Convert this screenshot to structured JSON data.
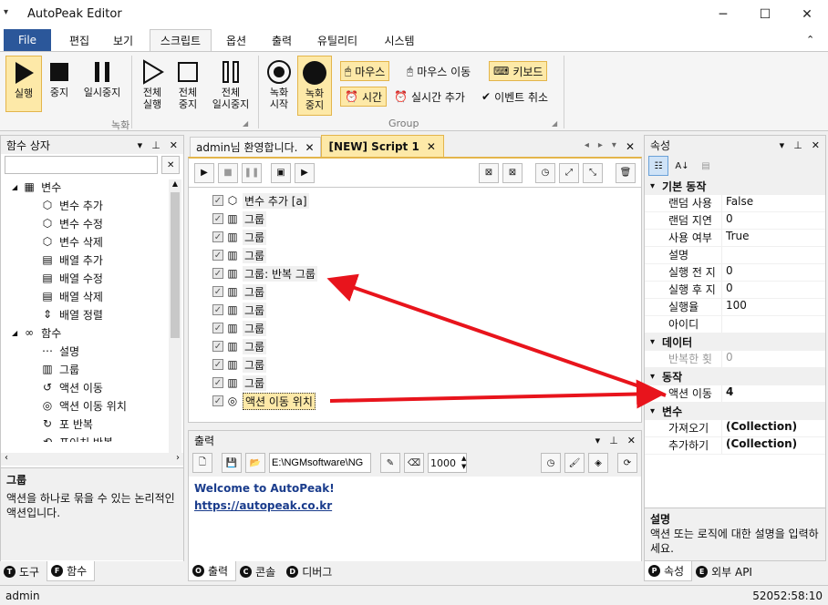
{
  "window": {
    "title": "AutoPeak Editor",
    "qa_icon": "dropdown-arrow-icon"
  },
  "menu": [
    "File",
    "편집",
    "보기",
    "스크립트",
    "옵션",
    "출력",
    "유틸리티",
    "시스템"
  ],
  "ribbon": {
    "run": "실행",
    "stop": "중지",
    "pause": "일시중지",
    "run_all": "전체\n실행",
    "stop_all": "전체\n중지",
    "pause_all": "전체\n일시중지",
    "rec_start": "녹화\n시작",
    "rec_stop": "녹화\n중지",
    "mouse": "마우스",
    "mouse_move": "마우스 이동",
    "keyboard": "키보드",
    "time": "시간",
    "realtime_add": "실시간 추가",
    "event_cancel": "이벤트 취소",
    "group_rec": "녹화",
    "group_group": "Group"
  },
  "left_panel": {
    "title": "함수 상자",
    "tree": [
      {
        "label": "변수",
        "level": 0,
        "icon": "variable-icon"
      },
      {
        "label": "변수 추가",
        "level": 1,
        "icon": "cube-add-icon"
      },
      {
        "label": "변수 수정",
        "level": 1,
        "icon": "cube-edit-icon"
      },
      {
        "label": "변수 삭제",
        "level": 1,
        "icon": "cube-delete-icon"
      },
      {
        "label": "배열 추가",
        "level": 1,
        "icon": "array-add-icon"
      },
      {
        "label": "배열 수정",
        "level": 1,
        "icon": "array-edit-icon"
      },
      {
        "label": "배열 삭제",
        "level": 1,
        "icon": "array-delete-icon"
      },
      {
        "label": "배열 정렬",
        "level": 1,
        "icon": "sort-icon"
      },
      {
        "label": "함수",
        "level": 0,
        "icon": "infinity-icon"
      },
      {
        "label": "설명",
        "level": 1,
        "icon": "comment-icon"
      },
      {
        "label": "그룹",
        "level": 1,
        "icon": "group-icon"
      },
      {
        "label": "액션 이동",
        "level": 1,
        "icon": "jump-icon"
      },
      {
        "label": "액션 이동 위치",
        "level": 1,
        "icon": "target-icon"
      },
      {
        "label": "포 반복",
        "level": 1,
        "icon": "loop-icon"
      },
      {
        "label": "포이치 반복",
        "level": 1,
        "icon": "foreach-icon"
      }
    ],
    "desc_title": "그룹",
    "desc_text": "액션을 하나로 묶을 수 있는 논리적인 액션입니다.",
    "tabs": [
      {
        "key": "T",
        "label": "도구"
      },
      {
        "key": "F",
        "label": "함수"
      }
    ]
  },
  "editor": {
    "tabs": [
      {
        "label": "admin님 환영합니다."
      },
      {
        "label": "[NEW] Script 1"
      }
    ],
    "items": [
      {
        "label": "변수 추가 [a]",
        "icon": "cube-add-icon"
      },
      {
        "label": "그룹",
        "icon": "group-icon"
      },
      {
        "label": "그룹",
        "icon": "group-icon"
      },
      {
        "label": "그룹",
        "icon": "group-icon"
      },
      {
        "label": "그룹: 반복 그룹",
        "icon": "group-icon"
      },
      {
        "label": "그룹",
        "icon": "group-icon"
      },
      {
        "label": "그룹",
        "icon": "group-icon"
      },
      {
        "label": "그룹",
        "icon": "group-icon"
      },
      {
        "label": "그룹",
        "icon": "group-icon"
      },
      {
        "label": "그룹",
        "icon": "group-icon"
      },
      {
        "label": "그룹",
        "icon": "group-icon"
      },
      {
        "label": "액션 이동 위치",
        "icon": "target-icon"
      }
    ]
  },
  "output": {
    "title": "출력",
    "path": "E:\\NGMsoftware\\NG",
    "count": "1000",
    "welcome": "Welcome to AutoPeak!",
    "link": "https://autopeak.co.kr",
    "tabs": [
      {
        "key": "O",
        "label": "출력"
      },
      {
        "key": "C",
        "label": "콘솔"
      },
      {
        "key": "D",
        "label": "디버그"
      }
    ]
  },
  "properties": {
    "title": "속성",
    "categories": [
      {
        "name": "기본 동작",
        "rows": [
          {
            "k": "랜덤 사용",
            "v": "False"
          },
          {
            "k": "랜덤 지연",
            "v": "0"
          },
          {
            "k": "사용 여부",
            "v": "True"
          },
          {
            "k": "설명",
            "v": ""
          },
          {
            "k": "실행 전 지",
            "v": "0"
          },
          {
            "k": "실행 후 지",
            "v": "0"
          },
          {
            "k": "실행율",
            "v": "100"
          },
          {
            "k": "아이디",
            "v": ""
          }
        ]
      },
      {
        "name": "데이터",
        "rows": [
          {
            "k": "반복한 횟",
            "v": "0",
            "muted": true
          }
        ]
      },
      {
        "name": "동작",
        "rows": [
          {
            "k": "액션 이동",
            "v": "4",
            "bold": true
          }
        ]
      },
      {
        "name": "변수",
        "rows": [
          {
            "k": "가져오기",
            "v": "(Collection)",
            "bold": true
          },
          {
            "k": "추가하기",
            "v": "(Collection)",
            "bold": true
          }
        ]
      }
    ],
    "desc_title": "설명",
    "desc_text": "액션 또는 로직에 대한 설명을 입력하세요.",
    "tabs": [
      {
        "key": "P",
        "label": "속성"
      },
      {
        "key": "E",
        "label": "외부 API"
      }
    ]
  },
  "status": {
    "user": "admin",
    "time": "52052:58:10"
  },
  "colors": {
    "accent": "#2b579a",
    "highlight": "#fde9a8",
    "arrow": "#e8141c",
    "link": "#1a3c8c"
  }
}
